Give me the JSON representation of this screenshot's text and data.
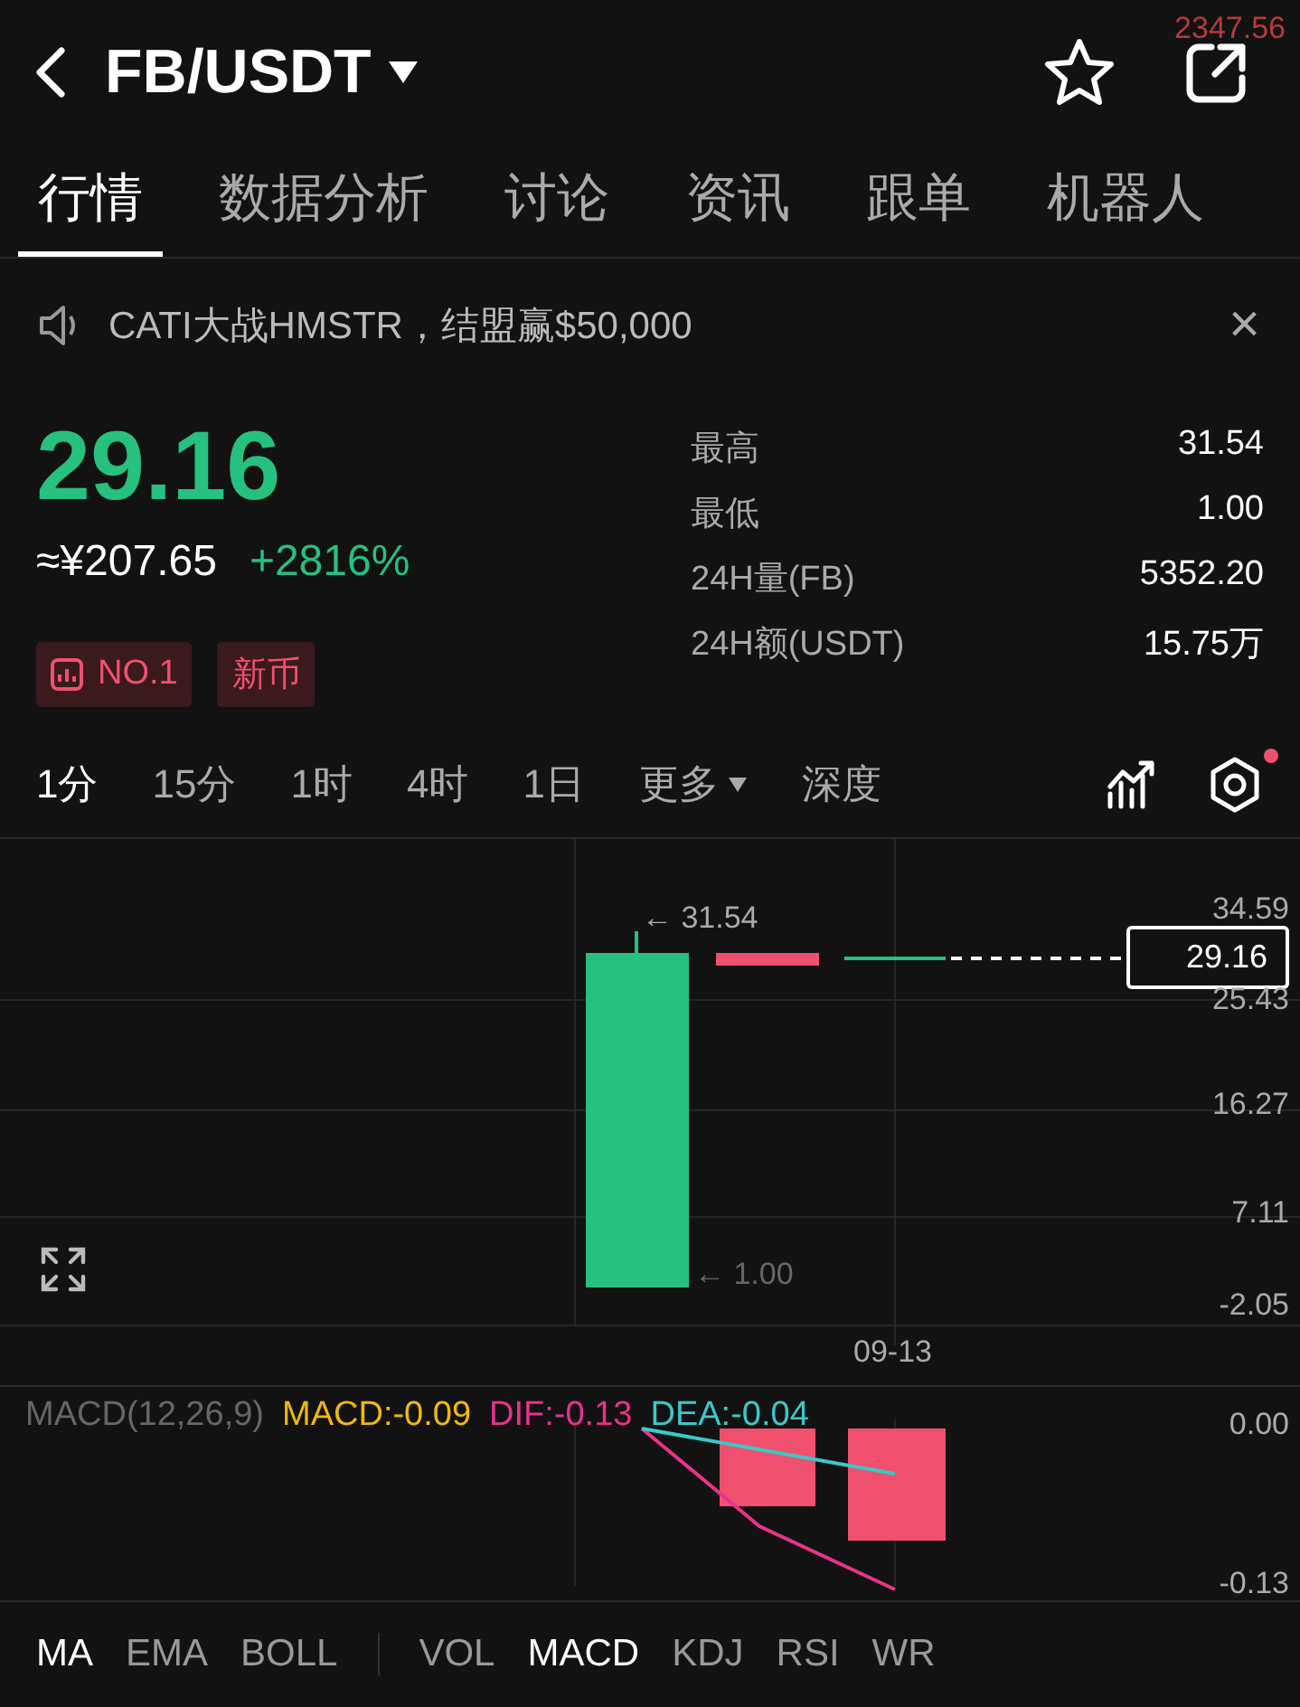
{
  "header": {
    "pair": "FB/USDT",
    "ticker_overlay": "2347.56"
  },
  "tabs": [
    {
      "label": "行情",
      "selected": true
    },
    {
      "label": "数据分析",
      "selected": false
    },
    {
      "label": "讨论",
      "selected": false
    },
    {
      "label": "资讯",
      "selected": false
    },
    {
      "label": "跟单",
      "selected": false
    },
    {
      "label": "机器人",
      "selected": false
    }
  ],
  "announcement": {
    "text": "CATI大战HMSTR，结盟赢$50,000",
    "close": "×"
  },
  "price": {
    "last": "29.16",
    "fiat": "≈¥207.65",
    "change": "+2816%"
  },
  "stats": [
    {
      "label": "最高",
      "value": "31.54"
    },
    {
      "label": "最低",
      "value": "1.00"
    },
    {
      "label": "24H量(FB)",
      "value": "5352.20"
    },
    {
      "label": "24H额(USDT)",
      "value": "15.75万"
    }
  ],
  "badges": [
    {
      "label": "NO.1",
      "kind": "rank"
    },
    {
      "label": "新币",
      "kind": "plain"
    }
  ],
  "timeframes": [
    {
      "label": "1分",
      "selected": true,
      "kind": "plain"
    },
    {
      "label": "15分",
      "selected": false,
      "kind": "plain"
    },
    {
      "label": "1时",
      "selected": false,
      "kind": "plain"
    },
    {
      "label": "4时",
      "selected": false,
      "kind": "plain"
    },
    {
      "label": "1日",
      "selected": false,
      "kind": "plain"
    },
    {
      "label": "更多",
      "selected": false,
      "kind": "menu"
    },
    {
      "label": "深度",
      "selected": false,
      "kind": "plain"
    }
  ],
  "chart": {
    "high_label": "← 31.54",
    "low_label": "← 1.00",
    "price_tag": "29.16",
    "yticks": [
      "34.59",
      "25.43",
      "16.27",
      "7.11",
      "-2.05"
    ],
    "xticks": [
      "09-13"
    ]
  },
  "macd": {
    "title": "MACD(12,26,9)",
    "values": [
      {
        "text": "MACD:-0.09",
        "color": "#f0b90b"
      },
      {
        "text": "DIF:-0.13",
        "color": "#e8338a"
      },
      {
        "text": "DEA:-0.04",
        "color": "#3cc8c8"
      }
    ],
    "yticks": [
      "0.00",
      "-0.13"
    ]
  },
  "indicators": {
    "main": [
      {
        "label": "MA",
        "selected": true
      },
      {
        "label": "EMA",
        "selected": false
      },
      {
        "label": "BOLL",
        "selected": false
      }
    ],
    "sub": [
      {
        "label": "VOL",
        "selected": false
      },
      {
        "label": "MACD",
        "selected": true
      },
      {
        "label": "KDJ",
        "selected": false
      },
      {
        "label": "RSI",
        "selected": false
      },
      {
        "label": "WR",
        "selected": false
      }
    ]
  }
}
